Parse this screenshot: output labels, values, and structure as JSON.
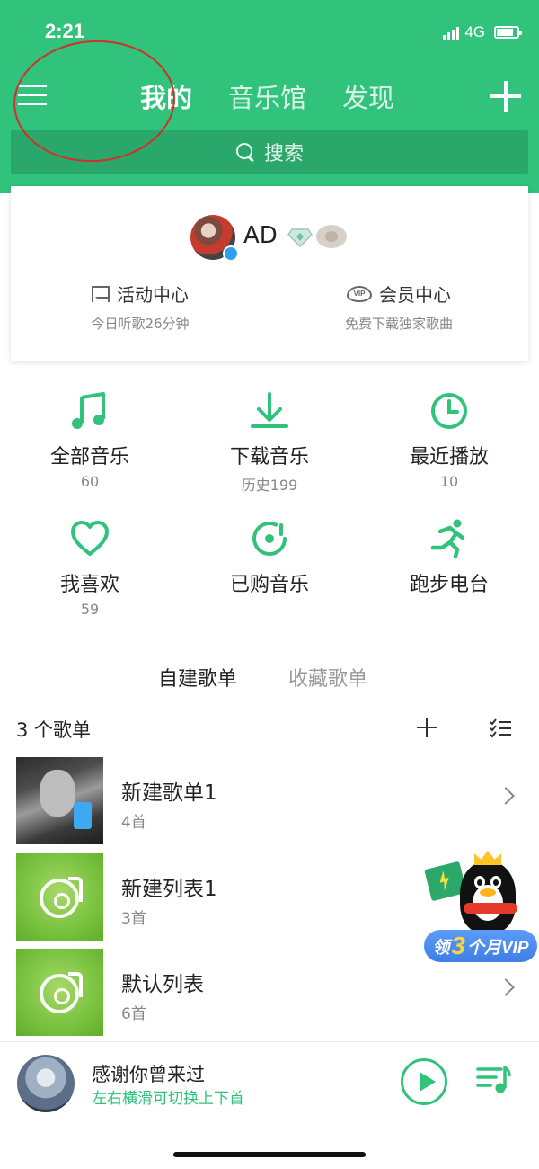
{
  "status_bar": {
    "time": "2:21",
    "network": "4G"
  },
  "nav": {
    "tabs": [
      "我的",
      "音乐馆",
      "发现"
    ],
    "active_tab": 0
  },
  "search": {
    "placeholder": "搜索"
  },
  "profile": {
    "username": "AD",
    "activity": {
      "label": "活动中心",
      "sub": "今日听歌26分钟"
    },
    "vip": {
      "label": "会员中心",
      "sub": "免费下载独家歌曲",
      "icon_text": "VIP"
    }
  },
  "grid": [
    {
      "icon": "music-note-icon",
      "label": "全部音乐",
      "count": "60"
    },
    {
      "icon": "download-icon",
      "label": "下载音乐",
      "count": "历史199"
    },
    {
      "icon": "clock-icon",
      "label": "最近播放",
      "count": "10"
    },
    {
      "icon": "heart-icon",
      "label": "我喜欢",
      "count": "59"
    },
    {
      "icon": "purchased-disc-icon",
      "label": "已购音乐",
      "count": ""
    },
    {
      "icon": "running-icon",
      "label": "跑步电台",
      "count": ""
    }
  ],
  "playlist_tabs": [
    "自建歌单",
    "收藏歌单"
  ],
  "playlist_count": "3 个歌单",
  "playlists": [
    {
      "title": "新建歌单1",
      "sub": "4首"
    },
    {
      "title": "新建列表1",
      "sub": "3首"
    },
    {
      "title": "默认列表",
      "sub": "6首"
    }
  ],
  "promo": {
    "prefix": "领",
    "number": "3",
    "suffix": "个月VIP"
  },
  "player": {
    "title": "感谢你曾来过",
    "hint": "左右横滑可切换上下首"
  },
  "colors": {
    "brand": "#31c27c",
    "search_bg": "#2aa86b",
    "annotation": "#d0302a",
    "promo_blue": "#3f7fe6"
  }
}
